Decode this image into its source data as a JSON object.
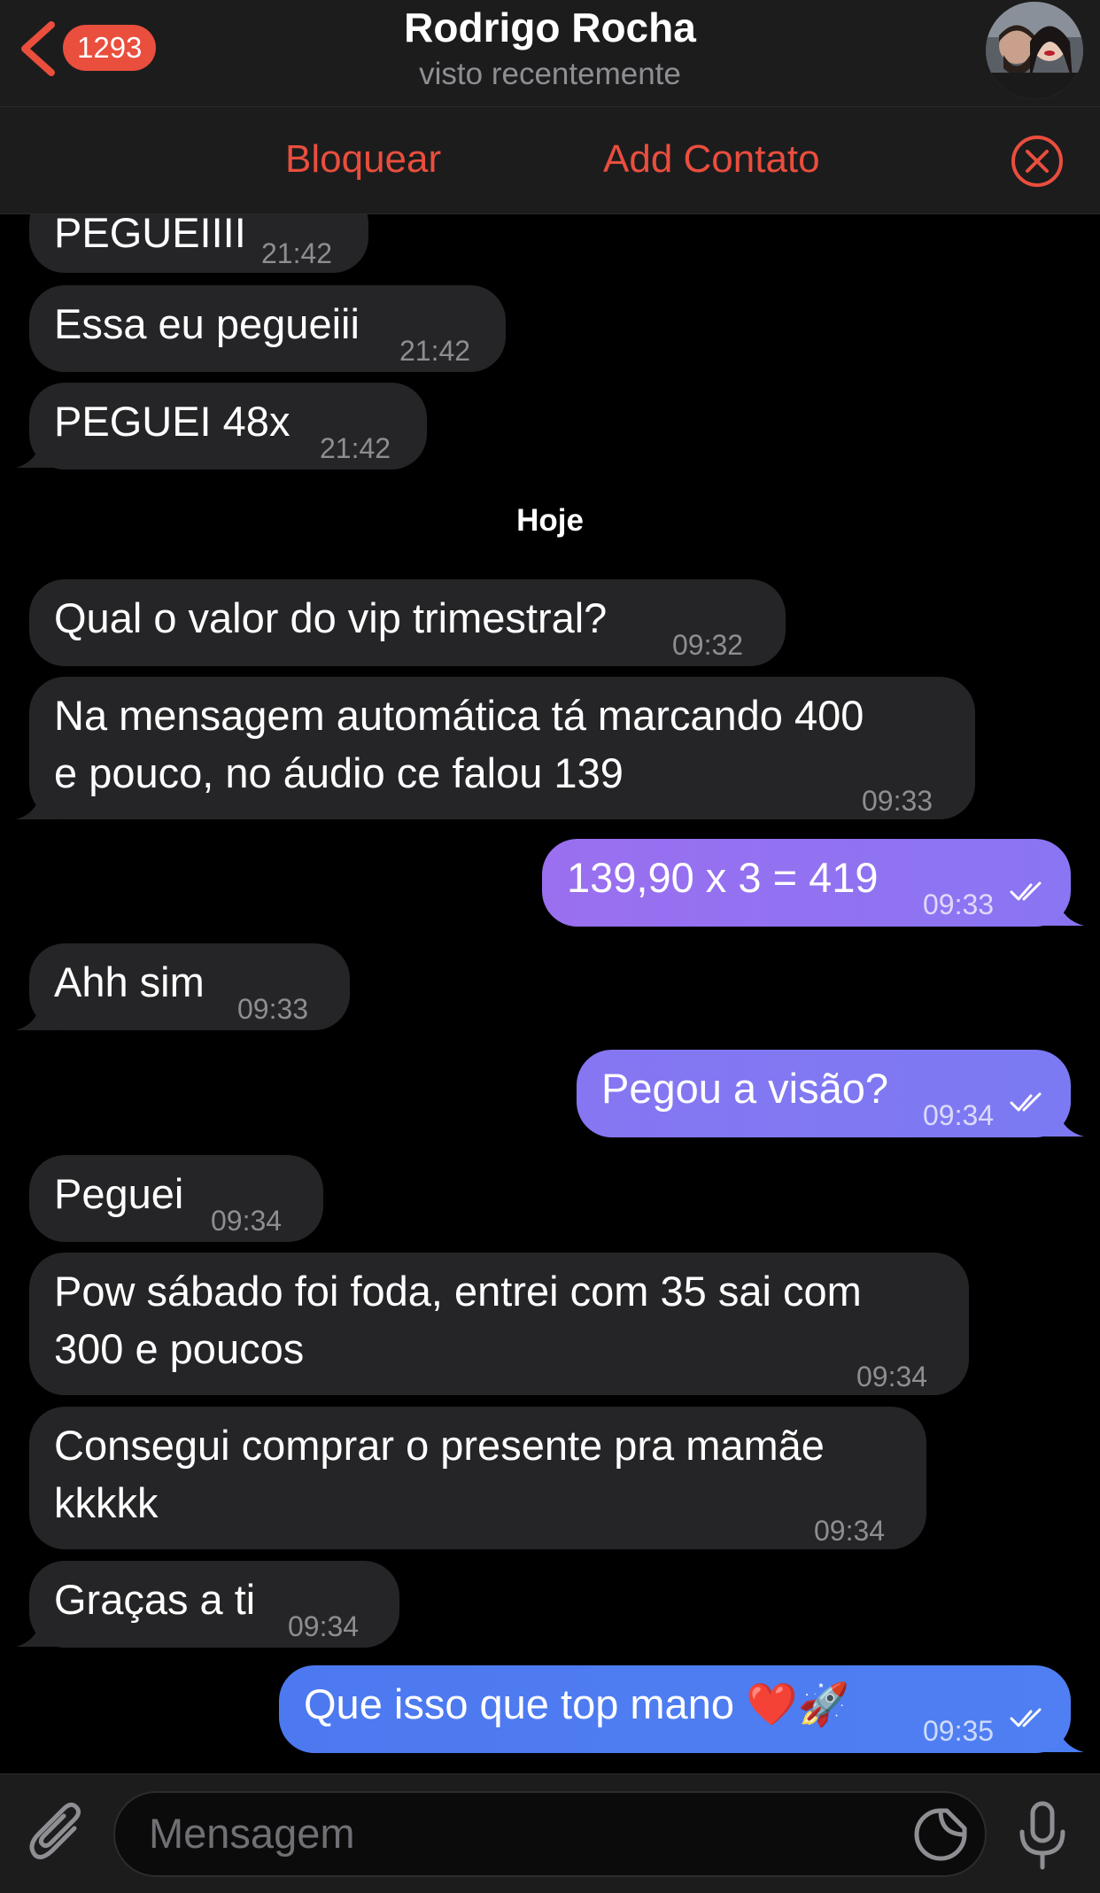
{
  "header": {
    "back_count": "1293",
    "contact_name": "Rodrigo Rocha",
    "status": "visto recentemente",
    "avatar_icon": "contact-avatar"
  },
  "actions": {
    "block": "Bloquear",
    "add_contact": "Add Contato"
  },
  "messages": [
    {
      "text": "PEGUEIIII",
      "time": "21:42",
      "dir": "in"
    },
    {
      "text": "Essa eu pegueiii",
      "time": "21:42",
      "dir": "in"
    },
    {
      "text": "PEGUEI 48x",
      "time": "21:42",
      "dir": "in"
    },
    {
      "text": "Qual o valor do vip trimestral?",
      "time": "09:32",
      "dir": "in"
    },
    {
      "text": "Na mensagem automática tá marcando 400\ne pouco, no áudio ce falou 139",
      "time": "09:33",
      "dir": "in"
    },
    {
      "text": "139,90 x 3 = 419",
      "time": "09:33",
      "dir": "out"
    },
    {
      "text": "Ahh sim",
      "time": "09:33",
      "dir": "in"
    },
    {
      "text": "Pegou a visão?",
      "time": "09:34",
      "dir": "out"
    },
    {
      "text": "Peguei",
      "time": "09:34",
      "dir": "in"
    },
    {
      "text": "Pow sábado foi foda, entrei com 35 sai com\n300 e poucos",
      "time": "09:34",
      "dir": "in"
    },
    {
      "text": "Consegui comprar o presente pra mamãe\nkkkkk",
      "time": "09:34",
      "dir": "in"
    },
    {
      "text": "Graças a ti",
      "time": "09:34",
      "dir": "in"
    },
    {
      "text": "Que isso que top mano ❤️🚀",
      "time": "09:35",
      "dir": "out"
    }
  ],
  "date_separator": "Hoje",
  "composer": {
    "placeholder": "Mensagem"
  },
  "colors": {
    "accent_red": "#ea4e3d",
    "incoming_bubble": "#252527",
    "outgoing_gradient_top": "#9b6cf0",
    "outgoing_gradient_bottom": "#4a7df0"
  }
}
